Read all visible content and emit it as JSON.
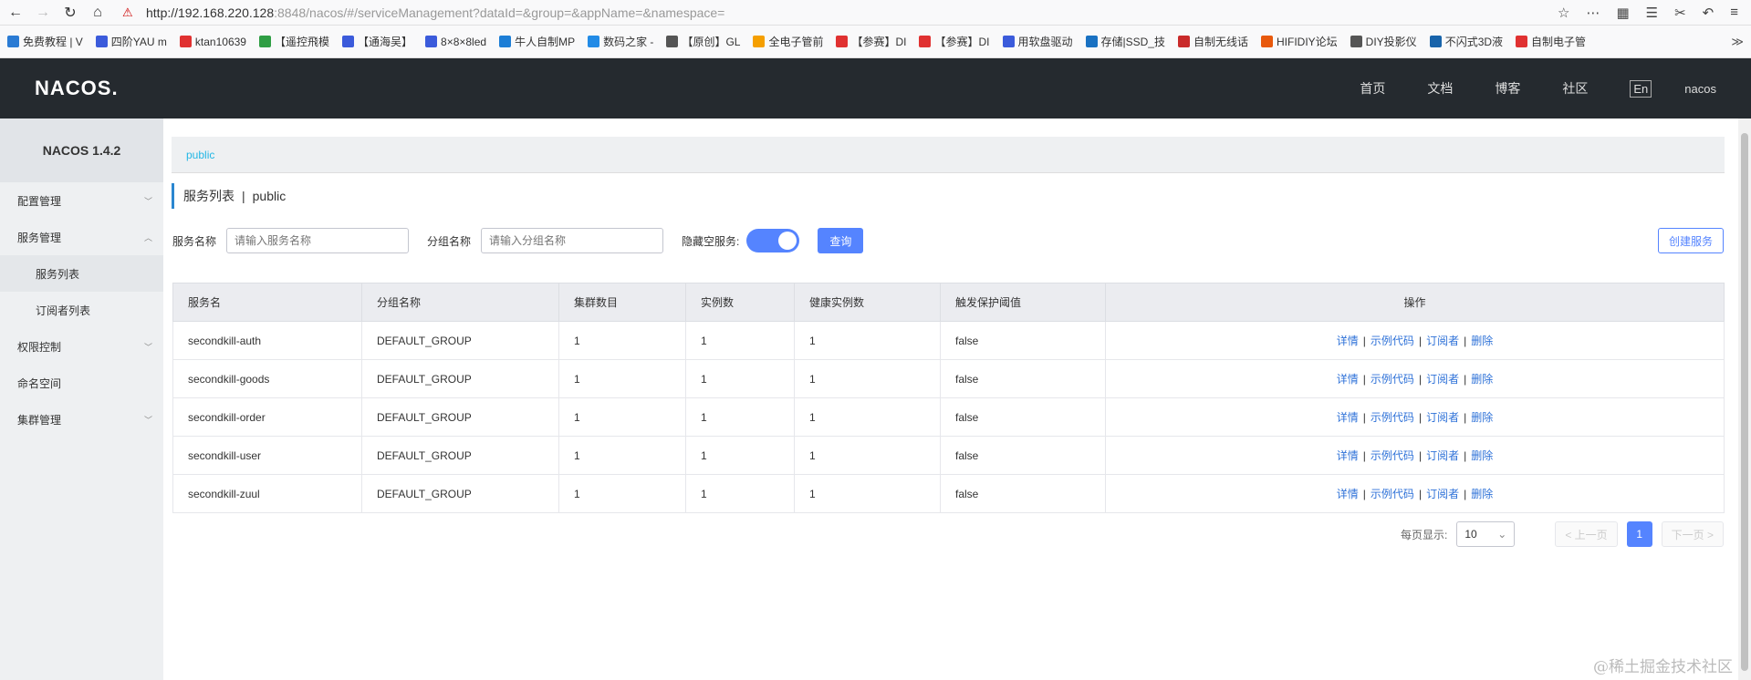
{
  "browser": {
    "url_host": "http://192.168.220.128",
    "url_rest": ":8848/nacos/#/serviceManagement?dataId=&group=&appName=&namespace=",
    "bookmarks": [
      {
        "label": "免费教程 | V",
        "color": "#2a7bd4"
      },
      {
        "label": "四阶YAU m",
        "color": "#3b5bdb"
      },
      {
        "label": "ktan10639",
        "color": "#e03131"
      },
      {
        "label": "【遥控飛模",
        "color": "#2f9e44"
      },
      {
        "label": "【通海吴】",
        "color": "#3b5bdb"
      },
      {
        "label": "8×8×8led",
        "color": "#3b5bdb"
      },
      {
        "label": "牛人自制MP",
        "color": "#1c7ed6"
      },
      {
        "label": "数码之家 -",
        "color": "#228be6"
      },
      {
        "label": "【原创】GL",
        "color": "#555"
      },
      {
        "label": "全电子管前",
        "color": "#f59f00"
      },
      {
        "label": "【参赛】DI",
        "color": "#e03131"
      },
      {
        "label": "【参赛】DI",
        "color": "#e03131"
      },
      {
        "label": "用软盘驱动",
        "color": "#3b5bdb"
      },
      {
        "label": "存储|SSD_技",
        "color": "#1971c2"
      },
      {
        "label": "自制无线话",
        "color": "#c92a2a"
      },
      {
        "label": "HIFIDIY论坛",
        "color": "#e8590c"
      },
      {
        "label": "DIY投影仪",
        "color": "#555"
      },
      {
        "label": "不闪式3D液",
        "color": "#1864ab"
      },
      {
        "label": "自制电子管",
        "color": "#e03131"
      }
    ]
  },
  "header": {
    "logo": "NACOS.",
    "nav": [
      "首页",
      "文档",
      "博客",
      "社区"
    ],
    "lang": "En",
    "user": "nacos"
  },
  "sidebar": {
    "version": "NACOS 1.4.2",
    "items": [
      {
        "label": "配置管理",
        "chevron": "﹀"
      },
      {
        "label": "服务管理",
        "chevron": "︿"
      },
      {
        "label": "服务列表",
        "sub": true,
        "active": true
      },
      {
        "label": "订阅者列表",
        "sub": true
      },
      {
        "label": "权限控制",
        "chevron": "﹀"
      },
      {
        "label": "命名空间",
        "chevron": ""
      },
      {
        "label": "集群管理",
        "chevron": "﹀"
      }
    ]
  },
  "main": {
    "breadcrumb": "public",
    "title": "服务列表",
    "title_sep": "|",
    "title_ns": "public",
    "filters": {
      "service_label": "服务名称",
      "service_placeholder": "请输入服务名称",
      "group_label": "分组名称",
      "group_placeholder": "请输入分组名称",
      "hide_empty_label": "隐藏空服务:",
      "query_label": "查询",
      "create_label": "创建服务"
    },
    "table": {
      "headers": [
        "服务名",
        "分组名称",
        "集群数目",
        "实例数",
        "健康实例数",
        "触发保护阈值",
        "操作"
      ],
      "ops": [
        "详情",
        "示例代码",
        "订阅者",
        "删除"
      ],
      "rows": [
        [
          "secondkill-auth",
          "DEFAULT_GROUP",
          "1",
          "1",
          "1",
          "false"
        ],
        [
          "secondkill-goods",
          "DEFAULT_GROUP",
          "1",
          "1",
          "1",
          "false"
        ],
        [
          "secondkill-order",
          "DEFAULT_GROUP",
          "1",
          "1",
          "1",
          "false"
        ],
        [
          "secondkill-user",
          "DEFAULT_GROUP",
          "1",
          "1",
          "1",
          "false"
        ],
        [
          "secondkill-zuul",
          "DEFAULT_GROUP",
          "1",
          "1",
          "1",
          "false"
        ]
      ]
    },
    "pager": {
      "per_page_label": "每页显示:",
      "page_size": "10",
      "prev": "< 上一页",
      "current": "1",
      "next": "下一页 >"
    }
  },
  "watermark": "@稀土掘金技术社区"
}
